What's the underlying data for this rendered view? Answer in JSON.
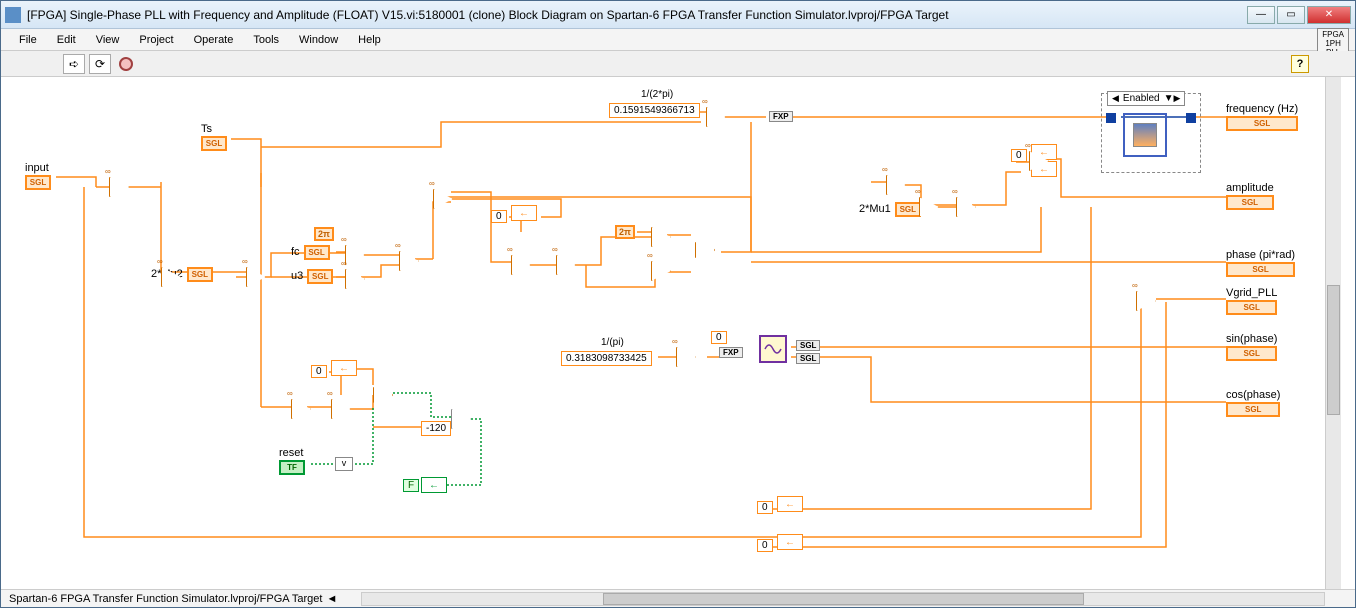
{
  "window": {
    "title": "[FPGA] Single-Phase PLL with Frequency and Amplitude (FLOAT) V15.vi:5180001 (clone) Block Diagram on Spartan-6 FPGA Transfer Function Simulator.lvproj/FPGA Target",
    "minimize": "—",
    "maximize": "▭",
    "close": "✕"
  },
  "menu": {
    "file": "File",
    "edit": "Edit",
    "view": "View",
    "project": "Project",
    "operate": "Operate",
    "tools": "Tools",
    "window": "Window",
    "help": "Help"
  },
  "fpga_badge": {
    "l1": "FPGA",
    "l2": "1PH",
    "l3": "PLL"
  },
  "toolbar": {
    "run": "➪",
    "run_cont": "⟳",
    "help": "?"
  },
  "probe": {
    "selector": "Enabled",
    "arrow": "▼"
  },
  "labels": {
    "input": "input",
    "ts": "Ts",
    "fc": "fc",
    "u3": "u3",
    "two_mu2": "2*Mu2",
    "two_mu1": "2*Mu1",
    "freq": "frequency (Hz)",
    "amp": "amplitude",
    "phase": "phase (pi*rad)",
    "vgrid": "Vgrid_PLL",
    "sin": "sin(phase)",
    "cos": "cos(phase)",
    "reset": "reset",
    "inv2pi_lbl": "1/(2*pi)",
    "invpi_lbl": "1/(pi)"
  },
  "consts": {
    "inv2pi": "0.1591549366713",
    "invpi": "0.3183098733425",
    "neg120": "-120",
    "zero": "0",
    "twopi": "2π"
  },
  "types": {
    "sgl": "SGL",
    "tf": "TF",
    "fxp": "FXP",
    "f": "F",
    "v": "v"
  },
  "status": {
    "path": "Spartan-6 FPGA Transfer Function Simulator.lvproj/FPGA Target",
    "arrow": "◄"
  }
}
